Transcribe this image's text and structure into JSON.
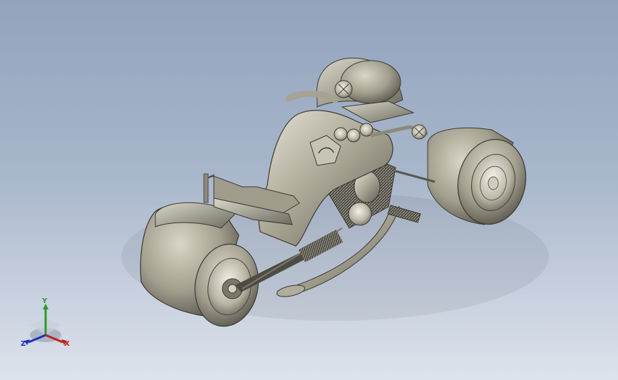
{
  "viewport": {
    "background_top": "#92a3bc",
    "background_bottom": "#dde3ec"
  },
  "model": {
    "part_color": "#8e8b7c",
    "shape": "three-wheeled-motorcycle"
  },
  "triad": {
    "x_label": "X",
    "y_label": "Y",
    "z_label": "Z",
    "x_color": "#c0201c",
    "y_color": "#2a9a2a",
    "z_color": "#2231b5"
  }
}
